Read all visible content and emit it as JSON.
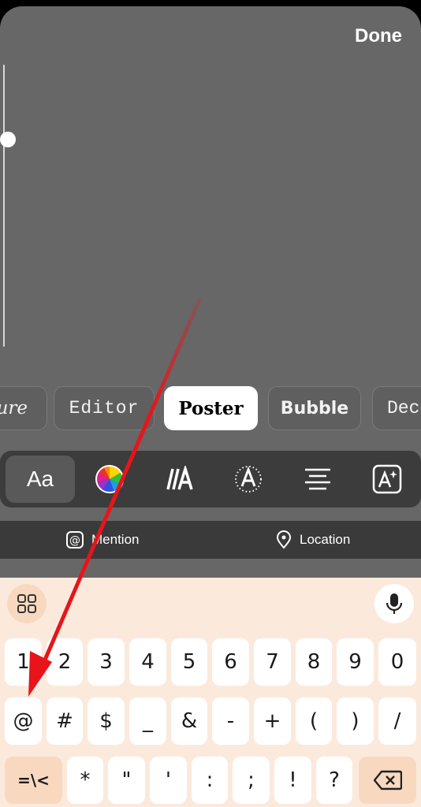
{
  "header": {
    "done_label": "Done"
  },
  "text_size_slider": {
    "level": 0.75
  },
  "font_styles": [
    {
      "label": "ure",
      "selected": false
    },
    {
      "label": "Editor",
      "selected": false
    },
    {
      "label": "Poster",
      "selected": true
    },
    {
      "label": "Bubble",
      "selected": false
    },
    {
      "label": "Deco",
      "selected": false
    }
  ],
  "toolbar": {
    "font_label": "Aa",
    "tools": [
      "font-icon",
      "color-wheel-icon",
      "text-animation-icon",
      "text-effect-icon",
      "align-center-icon",
      "sticker-text-icon"
    ]
  },
  "suggestions": {
    "mention_label": "Mention",
    "location_label": "Location"
  },
  "keyboard": {
    "number_row": [
      "1",
      "2",
      "3",
      "4",
      "5",
      "6",
      "7",
      "8",
      "9",
      "0"
    ],
    "symbol_row": [
      "@",
      "#",
      "$",
      "_",
      "&",
      "-",
      "+",
      "(",
      ")",
      "/"
    ],
    "bottom_row": [
      "*",
      "\"",
      "'",
      ":",
      ";",
      "!",
      "?"
    ],
    "more_symbols_label": "=\\<",
    "icons": [
      "apps-grid-icon",
      "microphone-icon",
      "backspace-icon"
    ]
  },
  "colors": {
    "canvas": "#676767",
    "keyboard_bg": "#fbeadc",
    "special_key": "#f8d9c0",
    "annotation_arrow": "#e8141b"
  }
}
